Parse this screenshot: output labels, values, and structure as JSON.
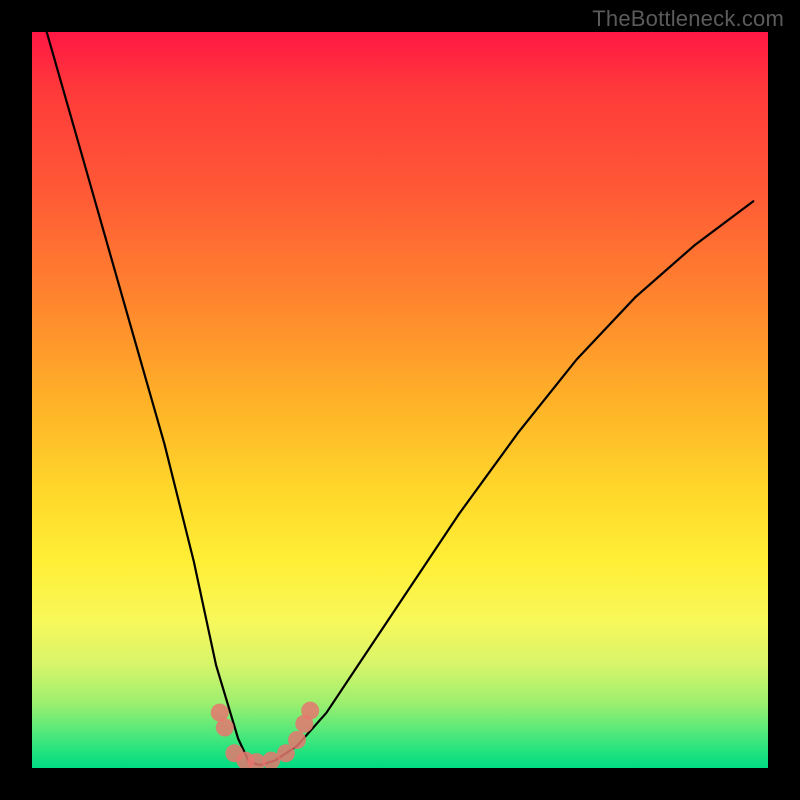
{
  "watermark": "TheBottleneck.com",
  "chart_data": {
    "type": "line",
    "title": "",
    "xlabel": "",
    "ylabel": "",
    "xlim": [
      0,
      1
    ],
    "ylim": [
      0,
      1
    ],
    "grid": false,
    "legend": false,
    "gradient_colors": {
      "top": "#ff1744",
      "mid_upper": "#ff8a2d",
      "mid": "#ffd62a",
      "mid_lower": "#f8f85a",
      "bottom": "#00db83"
    },
    "series": [
      {
        "name": "V-curve (black)",
        "color": "#000000",
        "x": [
          0.02,
          0.06,
          0.1,
          0.14,
          0.18,
          0.22,
          0.25,
          0.28,
          0.295,
          0.31,
          0.33,
          0.36,
          0.4,
          0.44,
          0.5,
          0.58,
          0.66,
          0.74,
          0.82,
          0.9,
          0.98
        ],
        "y": [
          1.0,
          0.86,
          0.72,
          0.58,
          0.44,
          0.28,
          0.14,
          0.04,
          0.008,
          0.004,
          0.01,
          0.03,
          0.075,
          0.135,
          0.225,
          0.345,
          0.455,
          0.555,
          0.64,
          0.71,
          0.77
        ]
      },
      {
        "name": "Valley markers (coral)",
        "color": "#e6776e",
        "type": "scatter",
        "x": [
          0.255,
          0.262,
          0.275,
          0.29,
          0.305,
          0.325,
          0.345,
          0.36,
          0.37,
          0.378
        ],
        "y": [
          0.075,
          0.055,
          0.02,
          0.01,
          0.008,
          0.01,
          0.02,
          0.038,
          0.06,
          0.078
        ]
      }
    ]
  }
}
